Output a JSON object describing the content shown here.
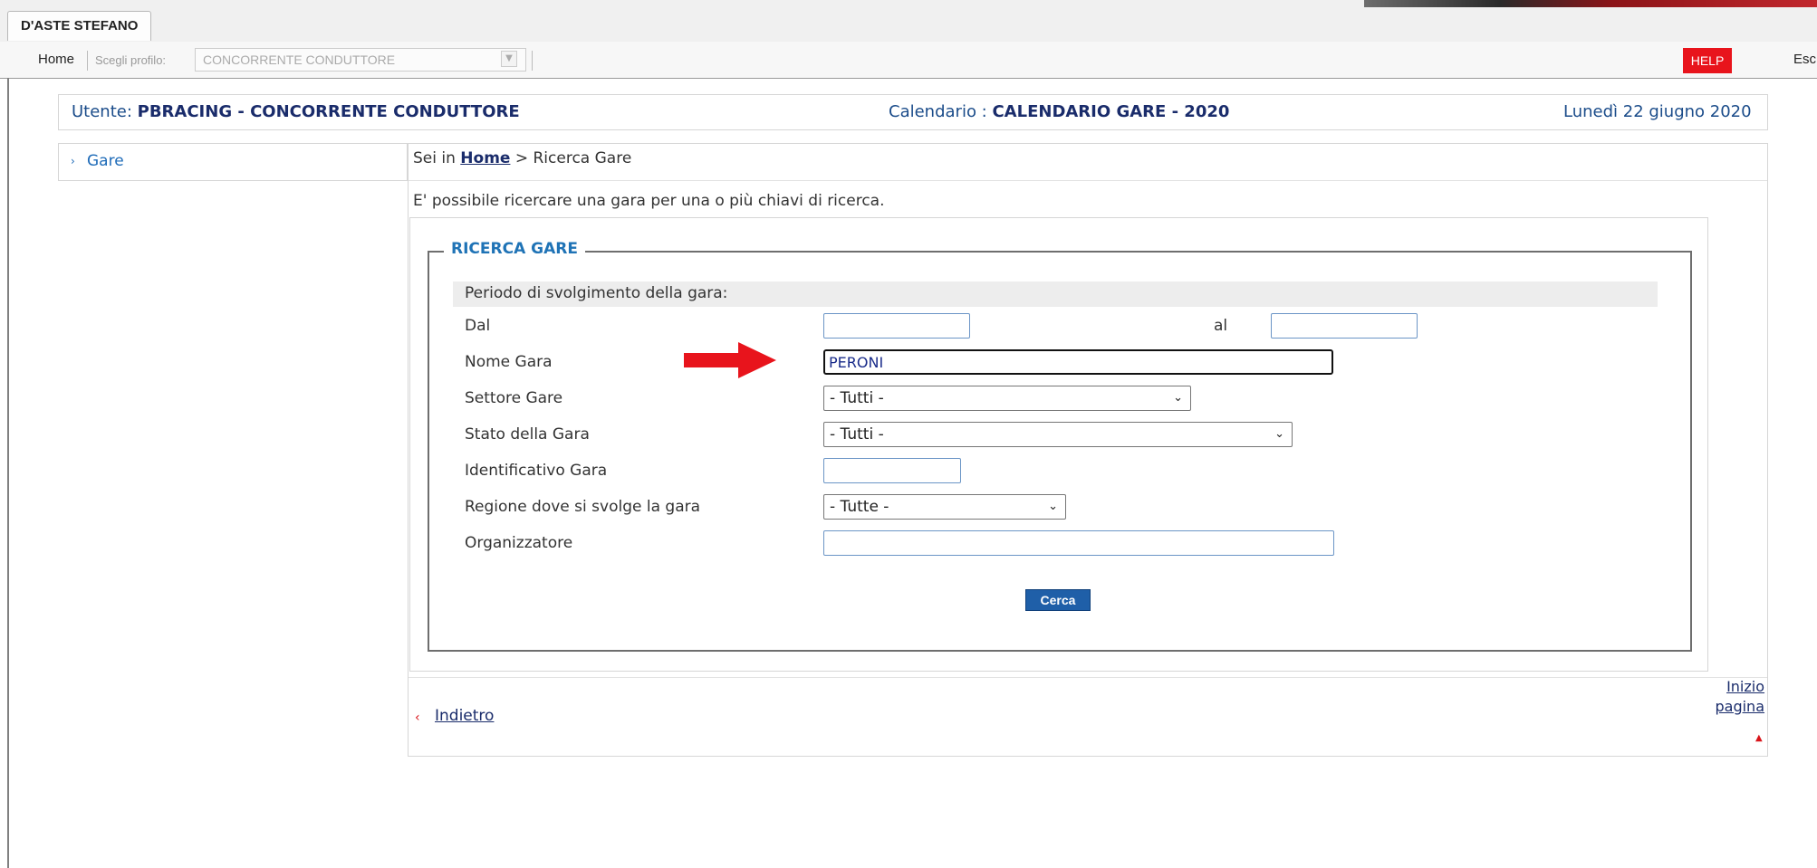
{
  "window": {
    "user_tab": "D'ASTE STEFANO"
  },
  "menubar": {
    "home": "Home",
    "profile_label": "Scegli profilo:",
    "profile_value": "CONCORRENTE CONDUTTORE",
    "help": "HELP",
    "exit": "Esci"
  },
  "infobar": {
    "user_prefix": "Utente: ",
    "user_value": "PBRACING - CONCORRENTE CONDUTTORE",
    "calendar_prefix": "Calendario : ",
    "calendar_value": "CALENDARIO GARE - 2020",
    "date": "Lunedì 22 giugno 2020"
  },
  "sidebar": {
    "items": [
      {
        "label": "Gare",
        "icon": "double-chevron-right-icon"
      }
    ]
  },
  "breadcrumb": {
    "prefix": "Sei in ",
    "home": "Home",
    "separator": " > ",
    "current": "Ricerca Gare"
  },
  "intro": "E' possibile ricercare una gara per una o più chiavi di ricerca.",
  "form": {
    "legend": "RICERCA GARE",
    "period_label": "Periodo di svolgimento della gara:",
    "from_label": "Dal",
    "from_value": "",
    "to_label": "al",
    "to_value": "",
    "name_label": "Nome Gara",
    "name_value": "PERONI",
    "sector_label": "Settore Gare",
    "sector_value": "- Tutti -",
    "status_label": "Stato della Gara",
    "status_value": "- Tutti -",
    "id_label": "Identificativo Gara",
    "id_value": "",
    "region_label": "Regione dove si svolge la gara",
    "region_value": "- Tutte -",
    "organizer_label": "Organizzatore",
    "organizer_value": "",
    "search_button": "Cerca"
  },
  "footer": {
    "back": "Indietro",
    "top_line1": "Inizio",
    "top_line2": "pagina"
  },
  "colors": {
    "accent_blue": "#1f73b6",
    "navy": "#1a2c6b",
    "help_red": "#e8141c",
    "annotation_red": "#e8141c"
  }
}
